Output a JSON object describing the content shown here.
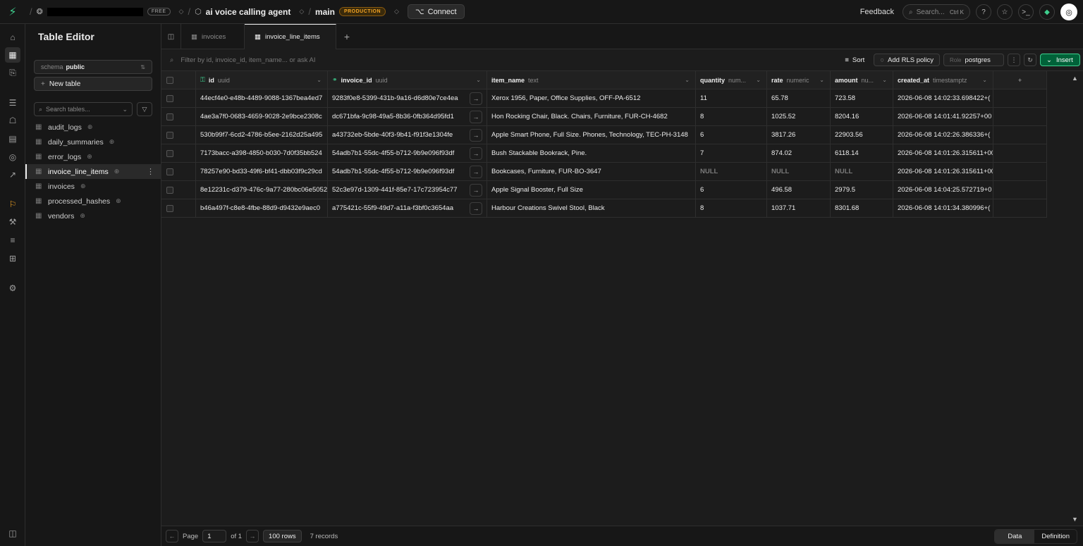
{
  "topbar": {
    "org_badge": "FREE",
    "project_name": "ai voice calling agent",
    "branch": "main",
    "branch_badge": "PRODUCTION",
    "connect_label": "Connect",
    "feedback_label": "Feedback",
    "search_placeholder": "Search...",
    "search_shortcut": "Ctrl K"
  },
  "panel": {
    "title": "Table Editor",
    "schema_label": "schema",
    "schema_value": "public",
    "new_table_label": "New table",
    "search_placeholder": "Search tables...",
    "tables": [
      {
        "name": "audit_logs"
      },
      {
        "name": "daily_summaries"
      },
      {
        "name": "error_logs"
      },
      {
        "name": "invoice_line_items"
      },
      {
        "name": "invoices"
      },
      {
        "name": "processed_hashes"
      },
      {
        "name": "vendors"
      }
    ],
    "active_table": "invoice_line_items"
  },
  "tabs": [
    {
      "label": "invoices"
    },
    {
      "label": "invoice_line_items"
    }
  ],
  "filterbar": {
    "placeholder": "Filter by id, invoice_id, item_name... or ask AI",
    "sort_label": "Sort",
    "rls_label": "Add RLS policy",
    "role_label": "Role",
    "role_value": "postgres",
    "insert_label": "Insert"
  },
  "grid": {
    "columns": [
      {
        "name": "id",
        "type": "uuid"
      },
      {
        "name": "invoice_id",
        "type": "uuid"
      },
      {
        "name": "item_name",
        "type": "text"
      },
      {
        "name": "quantity",
        "type": "num..."
      },
      {
        "name": "rate",
        "type": "numeric"
      },
      {
        "name": "amount",
        "type": "nu..."
      },
      {
        "name": "created_at",
        "type": "timestamptz"
      }
    ],
    "rows": [
      [
        "44ecf4e0-e48b-4489-9088-1367bea4ed7",
        "9283f0e8-5399-431b-9a16-d6d80e7ce4ea",
        "Xerox 1956, Paper, Office Supplies, OFF-PA-6512",
        "11",
        "65.78",
        "723.58",
        "2026-06-08 14:02:33.698422+("
      ],
      [
        "4ae3a7f0-0683-4659-9028-2e9bce2308c",
        "dc671bfa-9c98-49a5-8b36-0fb364d95fd1",
        "Hon Rocking Chair, Black. Chairs, Furniture, FUR-CH-4682",
        "8",
        "1025.52",
        "8204.16",
        "2026-06-08 14:01:41.92257+00"
      ],
      [
        "530b99f7-6cd2-4786-b5ee-2162d25a495",
        "a43732eb-5bde-40f3-9b41-f91f3e1304fe",
        "Apple Smart Phone, Full Size. Phones, Technology, TEC-PH-3148",
        "6",
        "3817.26",
        "22903.56",
        "2026-06-08 14:02:26.386336+("
      ],
      [
        "7173bacc-a398-4850-b030-7d0f35bb524",
        "54adb7b1-55dc-4f55-b712-9b9e096f93df",
        "Bush Stackable Bookrack, Pine.",
        "7",
        "874.02",
        "6118.14",
        "2026-06-08 14:01:26.315611+00"
      ],
      [
        "78257e90-bd33-49f6-bf41-dbb03f9c29cd",
        "54adb7b1-55dc-4f55-b712-9b9e096f93df",
        "Bookcases, Furniture, FUR-BO-3647",
        "NULL",
        "NULL",
        "NULL",
        "2026-06-08 14:01:26.315611+00"
      ],
      [
        "8e12231c-d379-476c-9a77-280bc06e5052",
        "52c3e97d-1309-441f-85e7-17c723954c77",
        "Apple Signal Booster, Full Size",
        "6",
        "496.58",
        "2979.5",
        "2026-06-08 14:04:25.572719+0"
      ],
      [
        "b46a497f-c8e8-4fbe-88d9-d9432e9aec0",
        "a775421c-55f9-49d7-a11a-f3bf0c3654aa",
        "Harbour Creations Swivel Stool, Black",
        "8",
        "1037.71",
        "8301.68",
        "2026-06-08 14:01:34.380996+("
      ]
    ]
  },
  "footer": {
    "page_label": "Page",
    "page_value": "1",
    "of_label": "of 1",
    "rows_label": "100 rows",
    "records_label": "7 records",
    "view_data": "Data",
    "view_definition": "Definition"
  },
  "colors": {
    "brand": "#3ecf8e",
    "insert_bg": "#006239",
    "production_badge": "#f5a524"
  }
}
